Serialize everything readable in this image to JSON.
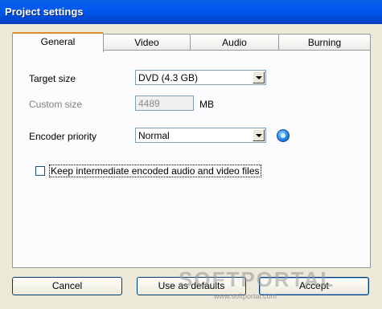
{
  "window": {
    "title": "Project settings"
  },
  "tabs": [
    {
      "label": "General",
      "active": true
    },
    {
      "label": "Video",
      "active": false
    },
    {
      "label": "Audio",
      "active": false
    },
    {
      "label": "Burning",
      "active": false
    }
  ],
  "general": {
    "target_size": {
      "label": "Target size",
      "value": "DVD (4.3 GB)"
    },
    "custom_size": {
      "label": "Custom size",
      "value": "4489",
      "unit": "MB"
    },
    "encoder_priority": {
      "label": "Encoder priority",
      "value": "Normal"
    },
    "keep_files": {
      "label": "Keep intermediate encoded audio and video files",
      "checked": false
    }
  },
  "buttons": {
    "cancel": "Cancel",
    "use_defaults": "Use as defaults",
    "accept": "Accept"
  },
  "watermark": {
    "text": "SOFTPORTAL",
    "url": "www.softportal.com"
  },
  "icons": {
    "info": "info-icon",
    "dropdown": "chevron-down-icon"
  },
  "colors": {
    "titlebar": "#0058ee",
    "tab_highlight": "#e68b2c",
    "face": "#ece9d8"
  }
}
